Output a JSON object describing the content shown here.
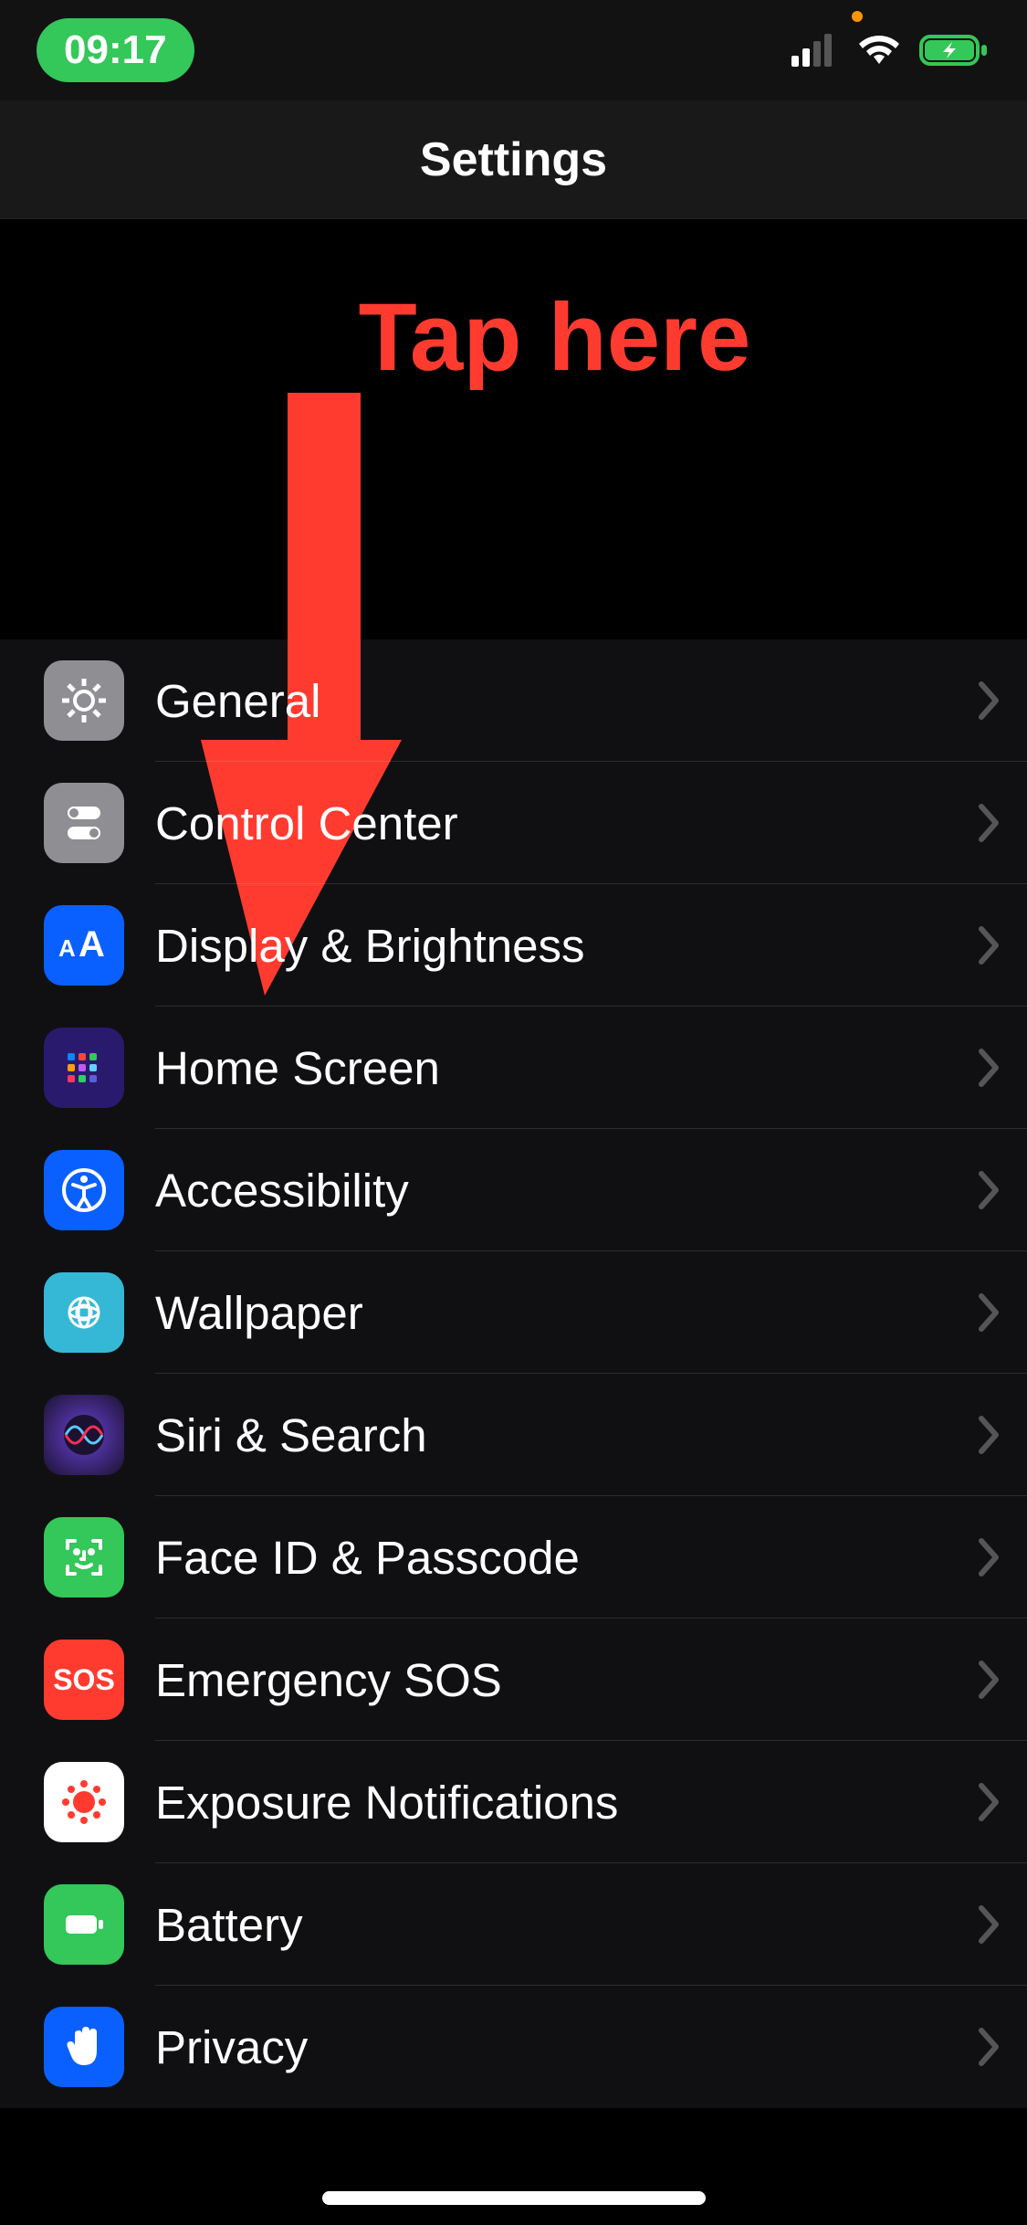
{
  "status": {
    "time": "09:17"
  },
  "nav": {
    "title": "Settings"
  },
  "annotation": {
    "text": "Tap here"
  },
  "rows": [
    {
      "label": "General"
    },
    {
      "label": "Control Center"
    },
    {
      "label": "Display & Brightness"
    },
    {
      "label": "Home Screen"
    },
    {
      "label": "Accessibility"
    },
    {
      "label": "Wallpaper"
    },
    {
      "label": "Siri & Search"
    },
    {
      "label": "Face ID & Passcode"
    },
    {
      "label": "Emergency SOS"
    },
    {
      "label": "Exposure Notifications"
    },
    {
      "label": "Battery"
    },
    {
      "label": "Privacy"
    }
  ]
}
